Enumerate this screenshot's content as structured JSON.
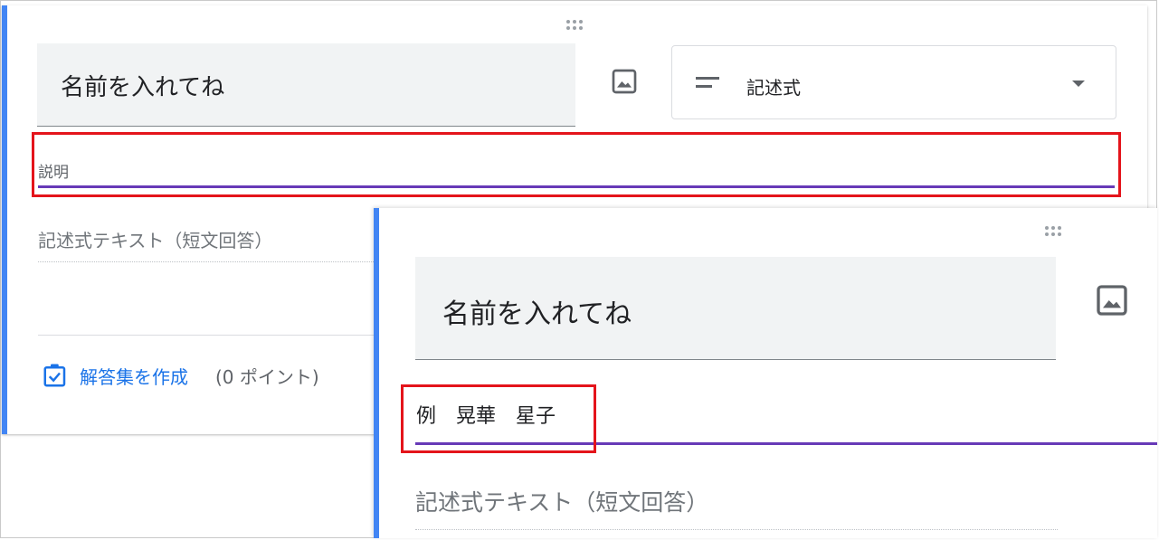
{
  "back_card": {
    "question_title": "名前を入れてね",
    "question_type": "記述式",
    "description_placeholder": "説明",
    "answer_placeholder": "記述式テキスト（短文回答）",
    "answer_key_label": "解答集を作成",
    "points_label": "(0 ポイント)"
  },
  "front_card": {
    "question_title": "名前を入れてね",
    "description_value": "例　晃華　星子",
    "answer_placeholder": "記述式テキスト（短文回答）"
  },
  "colors": {
    "accent": "#4285f4",
    "focus_underline": "#673ab7",
    "highlight_box": "#e4141b",
    "link": "#1a73e8"
  },
  "icons": [
    "drag-handle-icon",
    "image-icon",
    "short-answer-icon",
    "dropdown-arrow-icon",
    "checkbox-icon"
  ]
}
